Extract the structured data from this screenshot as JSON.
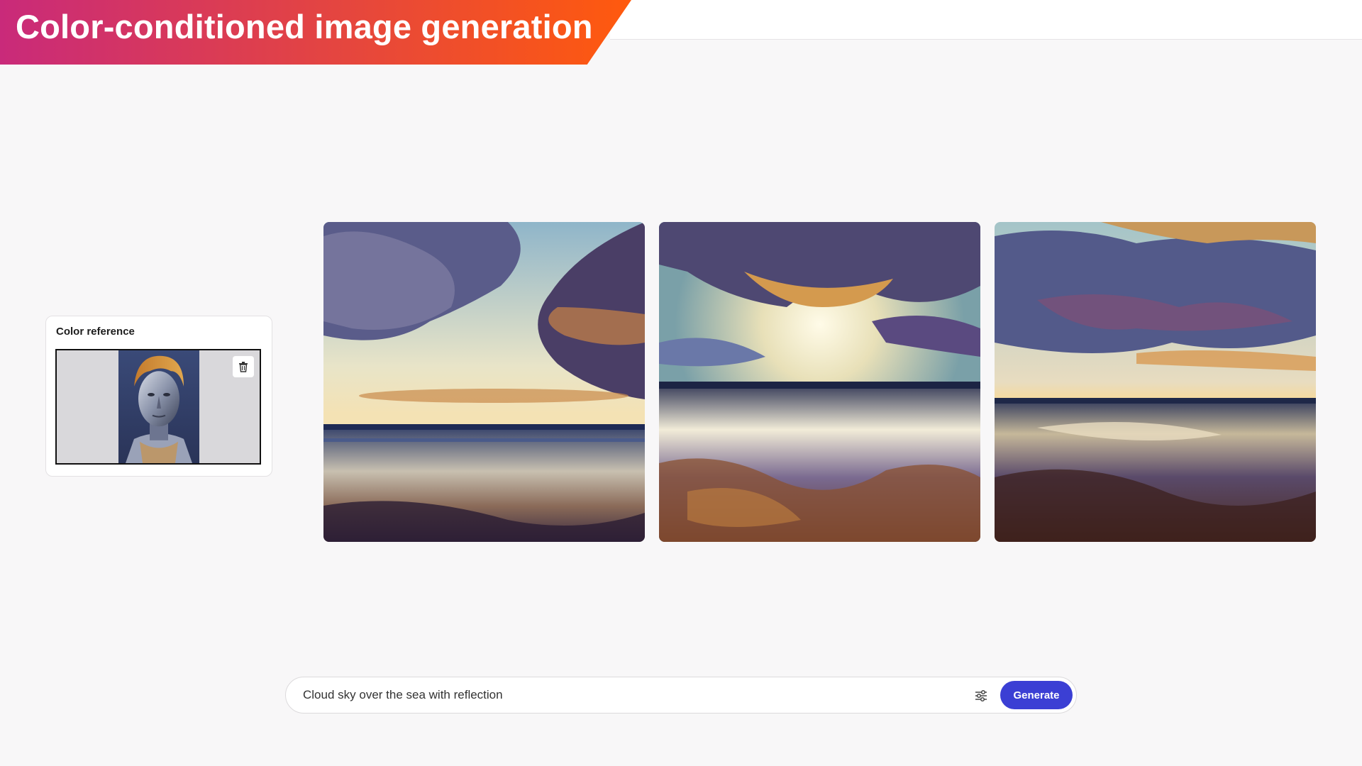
{
  "banner": {
    "title": "Color-conditioned image generation"
  },
  "color_reference": {
    "title": "Color reference",
    "delete_icon": "trash-icon"
  },
  "results": [
    {
      "icon": "generated-image-1"
    },
    {
      "icon": "generated-image-2"
    },
    {
      "icon": "generated-image-3"
    }
  ],
  "prompt_bar": {
    "value": "Cloud sky over the sea with reflection",
    "settings_icon": "sliders-icon",
    "generate_label": "Generate"
  },
  "colors": {
    "banner_start": "#c92a7a",
    "banner_end": "#ff5a0d",
    "accent": "#3b3fd4",
    "background": "#f8f7f8"
  }
}
